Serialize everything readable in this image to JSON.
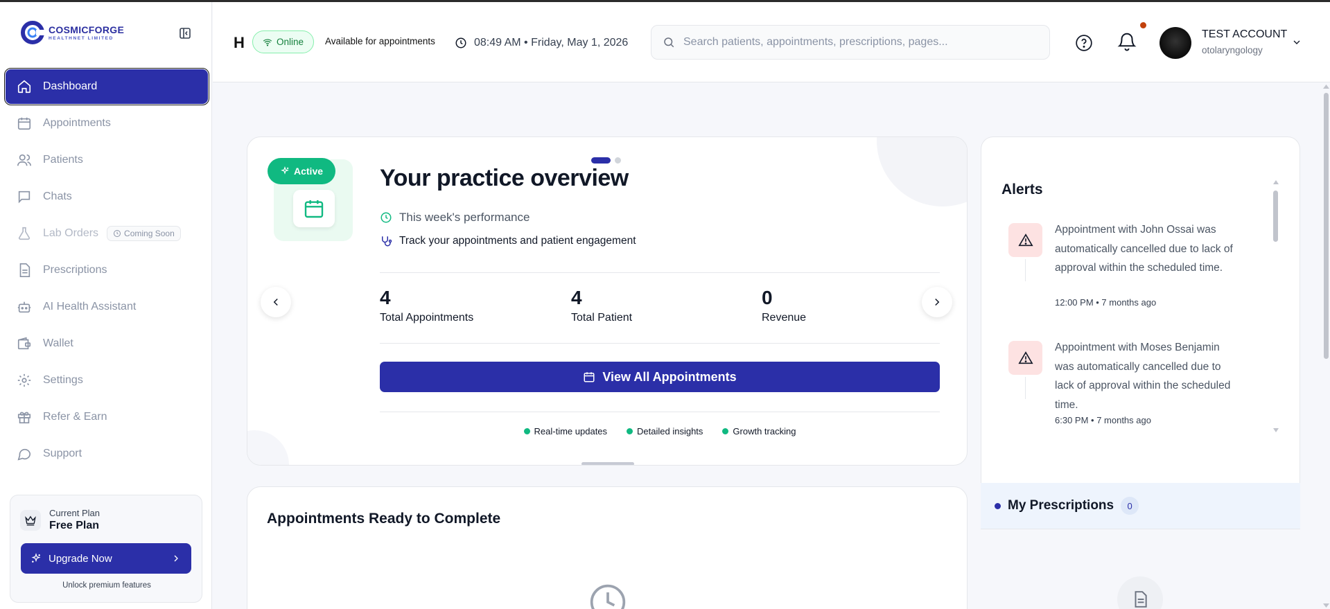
{
  "brand": {
    "name": "COSMICFORGE",
    "subtitle": "HEALTHNET LIMITED",
    "primary_color": "#2b2fa8",
    "accent_color": "#10b981"
  },
  "sidebar": {
    "collapse_icon": "sidebar-collapse-icon",
    "items": [
      {
        "label": "Dashboard",
        "icon": "home-icon",
        "active": true
      },
      {
        "label": "Appointments",
        "icon": "calendar-icon"
      },
      {
        "label": "Patients",
        "icon": "users-icon"
      },
      {
        "label": "Chats",
        "icon": "chat-icon"
      },
      {
        "label": "Lab Orders",
        "icon": "flask-icon",
        "badge": "Coming Soon",
        "disabled": true
      },
      {
        "label": "Prescriptions",
        "icon": "document-icon"
      },
      {
        "label": "AI Health Assistant",
        "icon": "robot-icon"
      },
      {
        "label": "Wallet",
        "icon": "wallet-icon"
      },
      {
        "label": "Settings",
        "icon": "gear-icon"
      },
      {
        "label": "Refer & Earn",
        "icon": "gift-icon"
      },
      {
        "label": "Support",
        "icon": "message-circle-icon"
      }
    ],
    "plan": {
      "label": "Current Plan",
      "name": "Free Plan",
      "upgrade_label": "Upgrade Now",
      "note": "Unlock premium features"
    }
  },
  "topbar": {
    "truncated_title": "H",
    "status": "Online",
    "availability": "Available for appointments",
    "datetime": "08:49 AM • Friday, May 1, 2026",
    "search_placeholder": "Search patients, appointments, prescriptions, pages...",
    "account_name": "TEST ACCOUNT",
    "account_role": "otolaryngology"
  },
  "overview": {
    "badge": "Active",
    "title": "Your practice overview",
    "subtitle": "This week's performance",
    "description": "Track your appointments and patient engagement",
    "slide_count": 2,
    "current_slide": 1,
    "stats": [
      {
        "value": "4",
        "label": "Total Appointments"
      },
      {
        "value": "4",
        "label": "Total Patient"
      },
      {
        "value": "0",
        "label": "Revenue"
      }
    ],
    "cta_label": "View All Appointments",
    "features": [
      "Real-time updates",
      "Detailed insights",
      "Growth tracking"
    ]
  },
  "alerts": {
    "title": "Alerts",
    "items": [
      {
        "text": "Appointment with John Ossai was automatically cancelled due to lack of approval within the scheduled time.",
        "time": "12:00 PM • 7 months ago"
      },
      {
        "text": "Appointment with Moses Benjamin was automatically cancelled due to lack of approval within the scheduled time.",
        "time": "6:30 PM • 7 months ago"
      }
    ]
  },
  "prescriptions": {
    "title": "My Prescriptions",
    "count": "0"
  },
  "ready": {
    "title": "Appointments Ready to Complete"
  }
}
